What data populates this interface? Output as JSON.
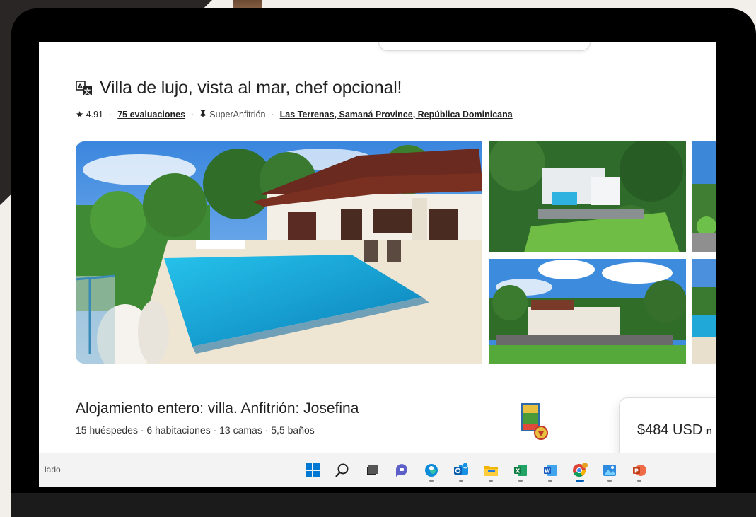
{
  "listing": {
    "title": "Villa de lujo, vista al mar, chef opcional!",
    "rating": "★ 4.91",
    "reviews_link": "75 evaluaciones",
    "superhost": "SuperAnfitrión",
    "location_link": "Las Terrenas, Samaná Province, República Dominicana",
    "heading": "Alojamiento entero: villa. Anfitrión: Josefina",
    "details": "15 huéspedes · 6 habitaciones · 13 camas · 5,5 baños",
    "price": "$484 USD",
    "price_suffix": "n"
  },
  "taskbar": {
    "status_text": "lado",
    "icons": [
      "windows-start-icon",
      "search-icon",
      "task-view-icon",
      "teams-chat-icon",
      "edge-icon",
      "outlook-icon",
      "file-explorer-icon",
      "excel-icon",
      "word-icon",
      "chrome-icon",
      "photos-icon",
      "powerpoint-icon"
    ],
    "active_icon": "chrome-icon"
  },
  "colors": {
    "accent": "#005fb8",
    "pool": "#1fa8d8",
    "sky": "#3a8fe0",
    "grass": "#4c9a3a"
  }
}
